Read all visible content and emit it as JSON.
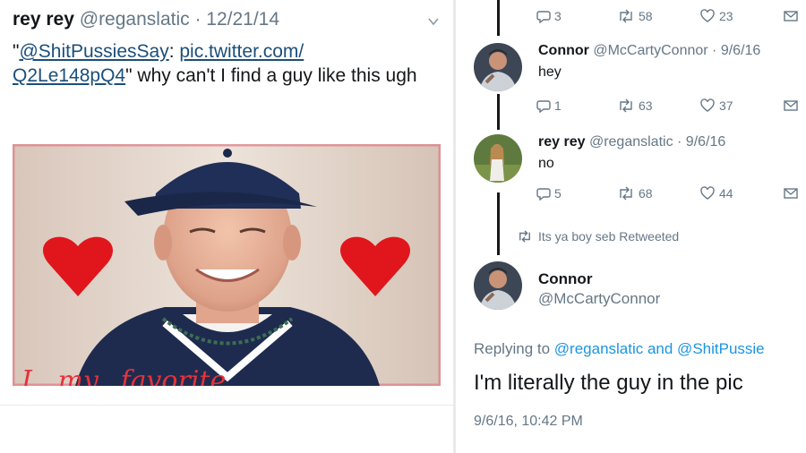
{
  "left_tweet": {
    "name": "rey rey",
    "handle": "@reganslatic",
    "separator": " · ",
    "date": "12/21/14",
    "quote_open": "\"",
    "mention": "@ShitPussiesSay",
    "colon": ": ",
    "link_part1": "pic.twitter.com/",
    "link_part2": "Q2Le148pQ4",
    "quote_close": "\"",
    "text_rest": " why can't I find a guy like this ugh",
    "media_caption": "I...my...favorite"
  },
  "thread": {
    "top_actions": {
      "replies": "3",
      "retweets": "58",
      "likes": "23"
    },
    "reply1": {
      "name": "Connor",
      "handle": "@McCartyConnor",
      "separator": " · ",
      "date": "9/6/16",
      "text": "hey",
      "actions": {
        "replies": "1",
        "retweets": "63",
        "likes": "37"
      }
    },
    "reply2": {
      "name": "rey rey",
      "handle": "@reganslatic",
      "separator": " · ",
      "date": "9/6/16",
      "text": "no",
      "actions": {
        "replies": "5",
        "retweets": "68",
        "likes": "44"
      }
    },
    "retweeted_by": "Its ya boy seb Retweeted",
    "main": {
      "name": "Connor",
      "handle": "@McCartyConnor",
      "replying_prefix": "Replying to ",
      "replying_to": "@reganslatic and @ShitPussie",
      "text": "I'm literally the guy in the pic",
      "timestamp": "9/6/16, 10:42 PM"
    }
  },
  "colors": {
    "link_dark": "#1b4f7a",
    "link_blue": "#1b95e0",
    "muted": "#657786",
    "heart_red": "#e0161c"
  }
}
